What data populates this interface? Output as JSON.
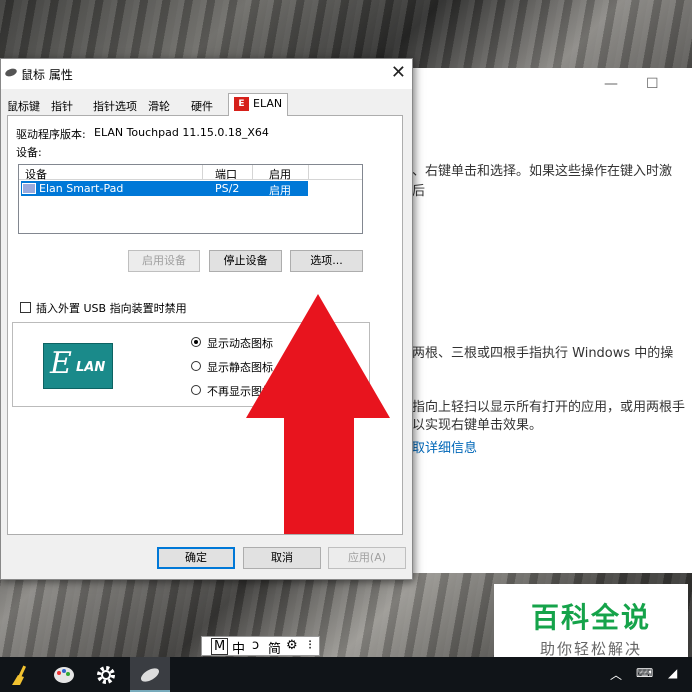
{
  "dialog": {
    "title": "鼠标 属性",
    "tabs": [
      "鼠标键",
      "指针",
      "指针选项",
      "滑轮",
      "硬件",
      "ELAN"
    ],
    "driver_label": "驱动程序版本:",
    "driver_version": "ELAN Touchpad 11.15.0.18_X64",
    "devices_label": "设备:",
    "device_table": {
      "headers": [
        "设备",
        "端口",
        "启用"
      ],
      "rows": [
        {
          "name": "Elan Smart-Pad",
          "port": "PS/2",
          "enabled": "启用"
        }
      ]
    },
    "buttons": {
      "enable_device": "启用设备",
      "stop_device": "停止设备",
      "options": "选项..."
    },
    "usb_checkbox": "插入外置 USB 指向装置时禁用",
    "radio_options": [
      "显示动态图标",
      "显示静态图标",
      "不再显示图标"
    ],
    "elan_logo_letter": "E",
    "elan_logo_rest": "LAN",
    "footer": {
      "ok": "确定",
      "cancel": "取消",
      "apply": "应用(A)"
    }
  },
  "settings_bg": {
    "min": "—",
    "max": "☐",
    "lines": [
      "、右键单击和选择。如果这些操作在键入时激",
      "后",
      "两根、三根或四根手指执行 Windows 中的操",
      "指向上轻扫以显示所有打开的应用，或用两根手",
      "以实现右键单击效果。"
    ],
    "link": "取详细信息"
  },
  "ime": {
    "items": [
      "M",
      "中",
      "ↄ",
      "简",
      "⚙",
      "⁝"
    ]
  },
  "watermark": {
    "title": "百科全说",
    "subtitle": "助你轻松解决"
  },
  "colors": {
    "arrow": "#e8141e",
    "accent": "#0078d7",
    "elan": "#1a8a8a",
    "watermark": "#15a34a"
  }
}
